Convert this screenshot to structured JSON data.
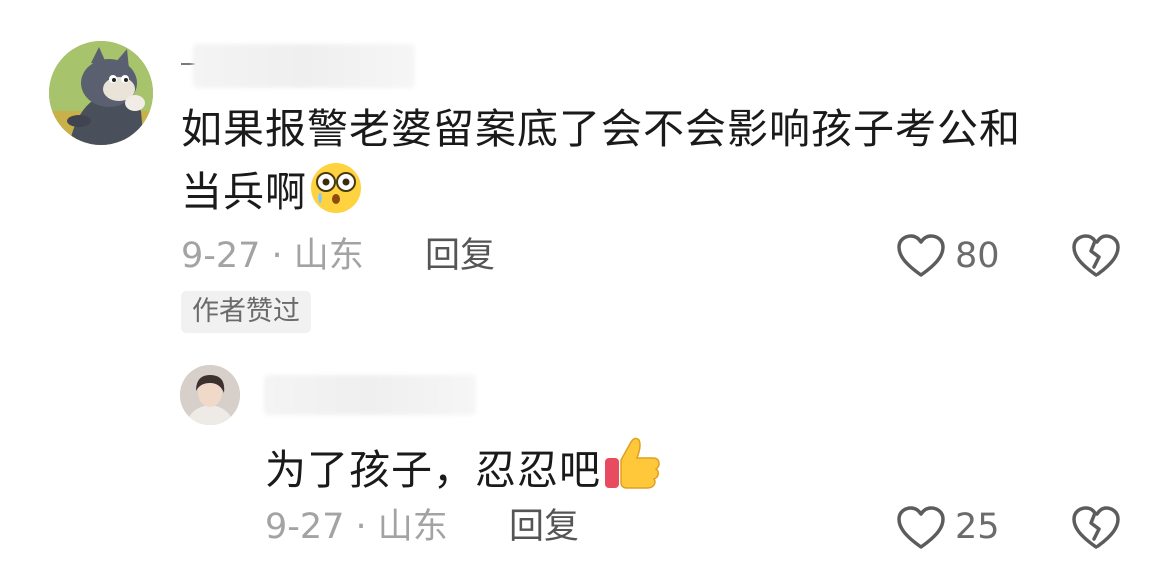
{
  "comments": [
    {
      "text_line1": "如果报警老婆留案底了会不会影响孩子考公和",
      "text_line2": "当兵啊",
      "date_location": "9-27 · 山东",
      "reply_label": "回复",
      "like_count": "80",
      "author_tag": "作者赞过",
      "emoji": "shocked-face-emoji",
      "avatar": "cartoon-cat-avatar"
    }
  ],
  "reply": {
    "text": "为了孩子，忍忍吧",
    "date_location": "9-27 · 山东",
    "reply_label": "回复",
    "like_count": "25",
    "emoji": "thumbs-up-emoji",
    "avatar": "young-man-avatar"
  },
  "icons": {
    "like": "heart-icon",
    "dislike": "broken-heart-icon"
  },
  "colors": {
    "text": "#1a1a1a",
    "meta": "#a3a3a3",
    "tag_bg": "#f1f1f1"
  }
}
